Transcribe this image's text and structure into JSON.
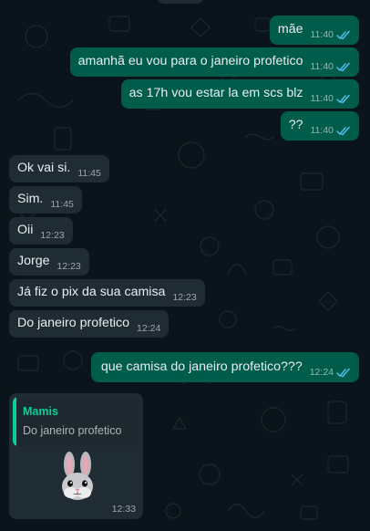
{
  "theme": {
    "background": "#0b141a",
    "outgoing_bubble": "#005c4b",
    "incoming_bubble": "#202c33",
    "read_check": "#53bdeb",
    "quote_accent": "#06cf9c"
  },
  "messages": {
    "outgoing_1": {
      "text": "mãe",
      "time": "11:40",
      "status": "read"
    },
    "outgoing_2": {
      "text": "amanhã eu vou para o janeiro profetico",
      "time": "11:40",
      "status": "read"
    },
    "outgoing_3": {
      "text": "as 17h vou estar la em scs blz",
      "time": "11:40",
      "status": "read"
    },
    "outgoing_4": {
      "text": "??",
      "time": "11:40",
      "status": "read"
    },
    "incoming_1": {
      "text": "Ok vai si.",
      "time": "11:45"
    },
    "incoming_2": {
      "text": "Sim.",
      "time": "11:45"
    },
    "incoming_3": {
      "text": "Oii",
      "time": "12:23"
    },
    "incoming_4": {
      "text": "Jorge",
      "time": "12:23"
    },
    "incoming_5": {
      "text": "Já fiz o pix da sua camisa",
      "time": "12:23"
    },
    "incoming_6": {
      "text": "Do janeiro  profetico",
      "time": "12:24"
    },
    "outgoing_5": {
      "text": "que camisa do janeiro profetico???",
      "time": "12:24",
      "status": "read"
    }
  },
  "reply_card": {
    "quote_author": "Mamis",
    "quote_text": "Do janeiro  profetico",
    "sticker_icon": "rabbit-sticker-icon",
    "time": "12:33"
  }
}
